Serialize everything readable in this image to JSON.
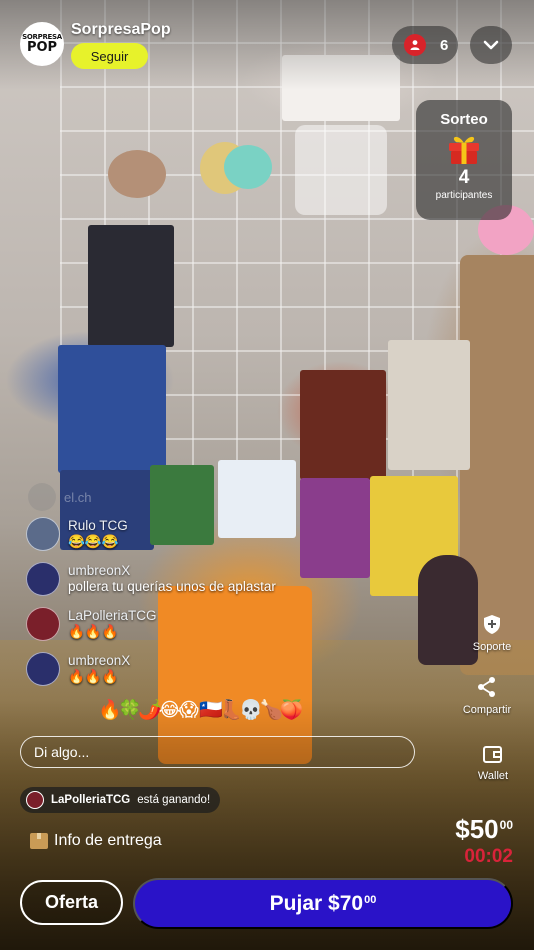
{
  "header": {
    "avatar_line1": "SORPRESA",
    "avatar_line2": "POP",
    "channel_name": "SorpresaPop",
    "follow_label": "Seguir",
    "viewer_count": "6",
    "viewer_icon": "person-icon",
    "collapse_icon": "chevron-down-icon"
  },
  "giveaway": {
    "title": "Sorteo",
    "icon": "gift-icon",
    "count": "4",
    "label": "participantes"
  },
  "chat": {
    "ghost_message": {
      "user": "el.ch"
    },
    "messages": [
      {
        "user": "Rulo TCG",
        "text": "😂😂😂",
        "avatar_color": "#5b6b8a"
      },
      {
        "user": "umbreonX",
        "text": "pollera tu querías unos de aplastar",
        "avatar_color": "#2a2f6b"
      },
      {
        "user": "LaPolleriaTCG",
        "text": "🔥🔥🔥",
        "avatar_color": "#7a1f2a"
      },
      {
        "user": "umbreonX",
        "text": "🔥🔥🔥",
        "avatar_color": "#2a2f6b"
      }
    ]
  },
  "reactions": [
    "🔥",
    "🍀",
    "🌶️",
    "😂",
    "😱",
    "🇨🇱",
    "👢",
    "💀",
    "🍗",
    "🍑"
  ],
  "side_actions": {
    "support": {
      "label": "Soporte",
      "icon": "shield-icon"
    },
    "share": {
      "label": "Compartir",
      "icon": "share-icon"
    },
    "wallet": {
      "label": "Wallet",
      "icon": "wallet-icon"
    }
  },
  "input": {
    "placeholder": "Di algo..."
  },
  "winner": {
    "user": "LaPolleriaTCG",
    "text": "está ganando!"
  },
  "auction": {
    "price_main": "$50",
    "price_cents": "00",
    "timer": "00:02",
    "timer_color": "#d8233a"
  },
  "shipping": {
    "label": "Info de entrega",
    "icon": "package-icon"
  },
  "buttons": {
    "offer_label": "Oferta",
    "bid_main": "Pujar $70",
    "bid_cents": "00",
    "bid_color": "#2a13c8"
  },
  "colors": {
    "follow_button": "#e7f22b",
    "viewer_badge": "#d8232a"
  }
}
